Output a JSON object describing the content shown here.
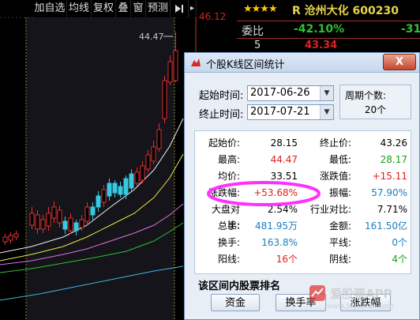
{
  "toolbar": {
    "items": [
      "加自选",
      "均线",
      "复权",
      "叠",
      "窗",
      "预测"
    ],
    "nav_icon": "play-end-icon"
  },
  "chart": {
    "price_high_right": "46.12",
    "peak_price_label": "44.47"
  },
  "quote": {
    "stars": "★★★★",
    "stock_label": "R 沧州大化 600230",
    "weibi_label": "委比",
    "weibi_value": "-42.10%",
    "weibi_extra": "-31",
    "order_no": "5",
    "order_price": "43.34"
  },
  "dialog": {
    "title": "个股K线区间统计",
    "close_label": "X",
    "start_label": "起始时间:",
    "start_value": "2017-06-26",
    "end_label": "终止时间:",
    "end_value": "2017-07-21",
    "period_label": "周期个数:",
    "period_value": "20个",
    "stats": [
      {
        "k1": "起始价:",
        "v1": "28.15",
        "c1": "#000000",
        "k2": "终止价:",
        "v2": "43.26",
        "c2": "#000000"
      },
      {
        "k1": "最高:",
        "v1": "44.47",
        "c1": "#e02020",
        "k2": "最低:",
        "v2": "28.17",
        "c2": "#18a018"
      },
      {
        "k1": "均价:",
        "v1": "33.51",
        "c1": "#000000",
        "k2": "涨跌值:",
        "v2": "+15.11",
        "c2": "#e02020"
      },
      {
        "k1": "涨跌幅:",
        "v1": "+53.68%",
        "c1": "#e02020",
        "k2": "振幅:",
        "v2": "57.90%",
        "c2": "#1a7fc0"
      },
      {
        "k1": "大盘对比:",
        "v1": "2.54%",
        "c1": "#000000",
        "k2": "行业对比:",
        "v2": "7.71%",
        "c2": "#000000"
      },
      {
        "k1": "总手:",
        "v1": "481.95万",
        "c1": "#1a7fc0",
        "k2": "金额:",
        "v2": "161.50亿",
        "c2": "#1a7fc0"
      },
      {
        "k1": "换手:",
        "v1": "163.8%",
        "c1": "#1a7fc0",
        "k2": "平线:",
        "v2": "0个",
        "c2": "#1a7fc0"
      },
      {
        "k1": "阳线:",
        "v1": "16个",
        "c1": "#e02020",
        "k2": "阴线:",
        "v2": "4个",
        "c2": "#18a018"
      }
    ],
    "ranking_label": "该区间内股票排名",
    "buttons": [
      "资金",
      "换手率",
      "涨跌幅"
    ],
    "watermark": "爱股票APP",
    "watermark_url": "www.5igupiao.com"
  },
  "colors": {
    "up": "#e02020",
    "down": "#18a018",
    "accent_blue": "#1a7fc0",
    "ma_yellow": "#e8e84a",
    "ma_white": "#f0f0f0",
    "ma_pink": "#e070e0",
    "ma_green": "#30c030",
    "ma_cyan": "#40b8d8",
    "highlight": "#ff30ff"
  }
}
